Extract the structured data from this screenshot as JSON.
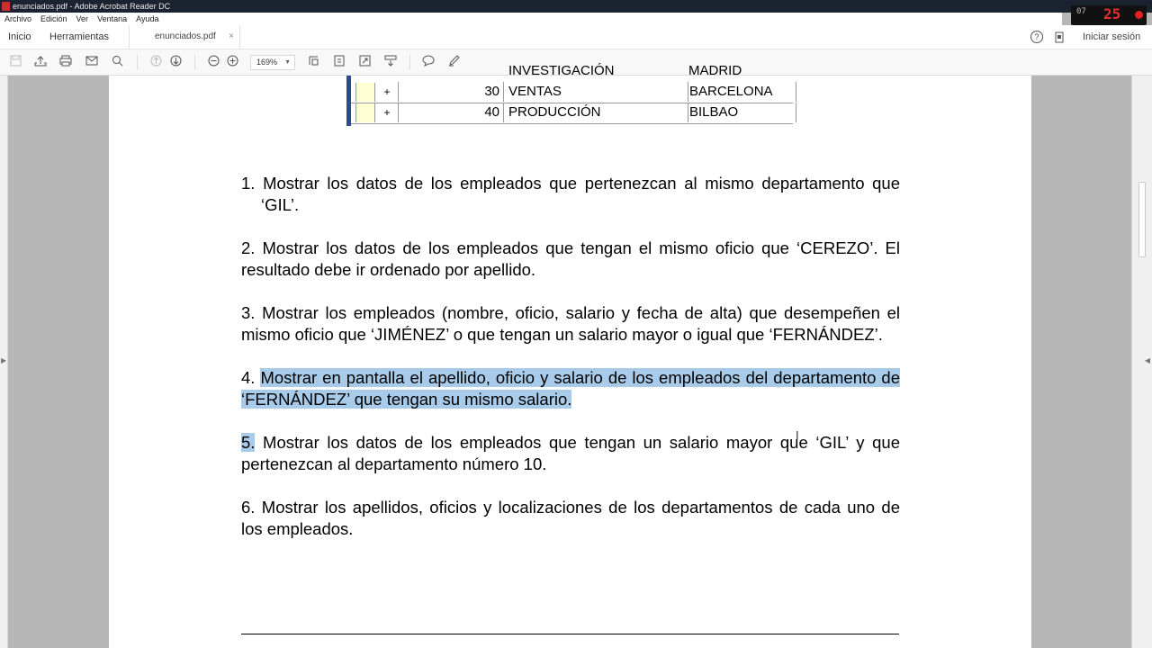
{
  "window": {
    "title": "enunciados.pdf - Adobe Acrobat Reader DC"
  },
  "recorder": {
    "digits": "07",
    "time": "25"
  },
  "menu": [
    "Archivo",
    "Edición",
    "Ver",
    "Ventana",
    "Ayuda"
  ],
  "tabs": {
    "home": "Inicio",
    "tools": "Herramientas",
    "document": "enunciados.pdf",
    "close": "×",
    "help": "?",
    "signin": "Iniciar sesión"
  },
  "toolbar": {
    "zoom": "169%"
  },
  "dept_table": {
    "cut_row": {
      "name": "INVESTIGACIÓN",
      "loc": "MADRID"
    },
    "rows": [
      {
        "expand": "+",
        "num": "30",
        "name": "VENTAS",
        "loc": "BARCELONA"
      },
      {
        "expand": "+",
        "num": "40",
        "name": "PRODUCCIÓN",
        "loc": "BILBAO"
      }
    ]
  },
  "exercises": [
    {
      "num": "1.",
      "text": "Mostrar los datos de los empleados que pertenezcan al mismo departamento que ‘GIL’."
    },
    {
      "num": "2.",
      "text": "Mostrar los datos de los empleados que tengan el mismo oficio que ‘CEREZO’. El resultado debe ir ordenado por apellido."
    },
    {
      "num": "3.",
      "text": "Mostrar los empleados (nombre, oficio, salario y fecha de alta) que desempeñen el mismo oficio que ‘JIMÉNEZ’ o que tengan un salario mayor o igual que ‘FERNÁNDEZ’."
    },
    {
      "num": "4.",
      "text": "Mostrar en pantalla el apellido, oficio y salario de los empleados del departamento de ‘FERNÁNDEZ’ que tengan su mismo salario."
    },
    {
      "num": "5.",
      "text": "Mostrar los datos de los empleados que tengan un salario mayor que ‘GIL’ y que pertenezcan al  departamento número 10."
    },
    {
      "num": "6.",
      "text": "Mostrar los apellidos, oficios y localizaciones de los departamentos de cada uno de los empleados."
    }
  ]
}
